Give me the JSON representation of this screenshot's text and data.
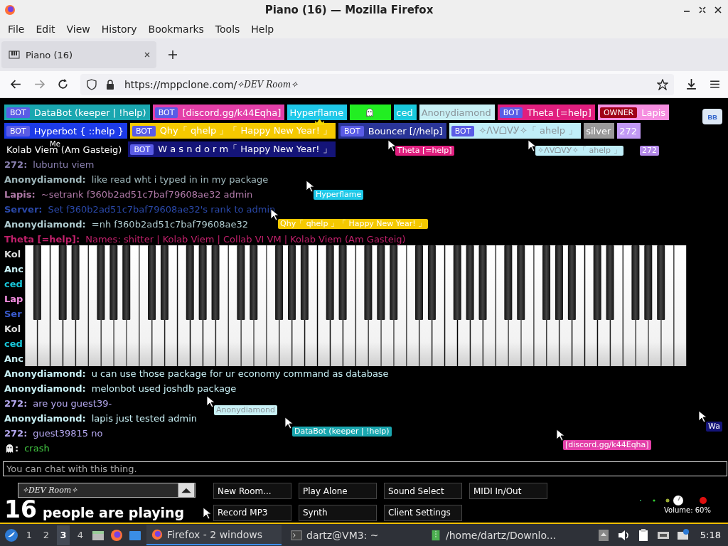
{
  "window": {
    "title": "Piano (16) — Mozilla Firefox"
  },
  "menu": [
    "File",
    "Edit",
    "View",
    "History",
    "Bookmarks",
    "Tools",
    "Help"
  ],
  "tabs": [
    {
      "label": "Piano (16)",
      "selected": true
    }
  ],
  "url": {
    "host": "https://mppclone.com/",
    "path": "✧DEV Room✧"
  },
  "participant_rows": [
    {
      "users": [
        {
          "badge": "BOT",
          "name": "DataBot (keeper | !help)",
          "color": "#1aa7b0"
        },
        {
          "badge": "BOT",
          "name": "[discord.gg/k44Eqha]",
          "color": "#e33fa8"
        },
        {
          "name": "Hyperflame",
          "color": "#1ec8e8"
        },
        {
          "kind": "ghost",
          "color": "#22ee22"
        },
        {
          "name": "ced",
          "color": "#19c9dc"
        },
        {
          "name": "Anonydiamond",
          "color": "#c8f0f5"
        },
        {
          "badge": "BOT",
          "name": "Theta [=help]",
          "color": "#e01e7e"
        },
        {
          "badge": "OWNER",
          "name": "Lapis",
          "color": "#f58ee0"
        }
      ]
    },
    {
      "users": [
        {
          "badge": "BOT",
          "name": "Hyperbot { ::help }",
          "color": "#1d3be8"
        },
        {
          "badge": "BOT",
          "name": "Qhy「 qhelp 」「 Happy New Year! 」",
          "color": "#f5c900"
        },
        {
          "badge": "BOT",
          "name": "Bouncer [//help]",
          "color": "#2a3598"
        },
        {
          "badge": "BOT",
          "name": "✧ᐱᐯᗝᐯᎩ✧「 ahelp 」",
          "color": "#c0eef8"
        },
        {
          "name": "silver",
          "color": "#999999"
        },
        {
          "name": "272",
          "color": "#c29af5"
        }
      ]
    },
    {
      "users": [
        {
          "name": "Kolab Viem (Am Gasteig)",
          "color": "#000000"
        },
        {
          "badge": "BOT",
          "name": "W a s n d o r m「 Happy New Year! 」",
          "color": "#141478"
        }
      ]
    }
  ],
  "corner_button": "ʙʙ",
  "chat": [
    {
      "kind": "message",
      "name": "272:",
      "text": "lubuntu viem",
      "color": "#8a80b0"
    },
    {
      "kind": "message",
      "name": "Anonydiamond:",
      "text": "like read wht i typed in in my package",
      "color": "#a0b8bc"
    },
    {
      "kind": "message",
      "name": "Lapis:",
      "text": "~setrank f360b2ad51c7baf79608ae32 admin",
      "color": "#b07aa8"
    },
    {
      "kind": "message",
      "name": "Server:",
      "text": "Set f360b2ad51c7baf79608ae32's rank to admin",
      "color": "#2a48a8"
    },
    {
      "kind": "message",
      "name": "Anonydiamond:",
      "text": "=nh f360b2ad51c7baf79608ae32",
      "color": "#b0ccd0"
    },
    {
      "kind": "message",
      "name": "Theta [=help]:",
      "text": "Names: shitter | Kolab Viem | Collab VI VM | Kolab Viem (Am Gasteig)",
      "color": "#c0206a"
    },
    {
      "kind": "stub",
      "name": "Kol",
      "color": "#dddddd"
    },
    {
      "kind": "stub",
      "name": "Anc",
      "color": "#c8f0f5"
    },
    {
      "kind": "stub",
      "name": "ced",
      "color": "#19c9dc"
    },
    {
      "kind": "stub",
      "name": "Lap",
      "color": "#f58ee0"
    },
    {
      "kind": "stub",
      "name": "Ser",
      "color": "#3a5cd0"
    },
    {
      "kind": "stub",
      "name": "Kol",
      "color": "#dddddd"
    },
    {
      "kind": "stub",
      "name": "ced",
      "color": "#19c9dc"
    },
    {
      "kind": "stub",
      "name": "Anc",
      "color": "#c8f0f5"
    },
    {
      "kind": "message",
      "name": "Anonydiamond:",
      "text": "u can use those package for ur economy command as database",
      "color": "#c8f0f5"
    },
    {
      "kind": "message",
      "name": "Anonydiamond:",
      "text": "melonbot used joshdb package",
      "color": "#c8f0f5"
    },
    {
      "kind": "message",
      "name": "272:",
      "text": "are you guest39-",
      "color": "#b5a8f0"
    },
    {
      "kind": "message",
      "name": "Anonydiamond:",
      "text": "lapis just tested admin",
      "color": "#c8f0f5"
    },
    {
      "kind": "message",
      "name": "272:",
      "text": "guest39815 no",
      "color": "#b5a8f0"
    },
    {
      "kind": "ghost",
      "name": ":",
      "text": "crash",
      "color": "#44cc44"
    }
  ],
  "cursors": [
    {
      "pointer": true,
      "label": "Theta [=help]",
      "color": "#e01e7e"
    },
    {
      "pointer": true,
      "label": "✧ᐱᐯᗝᐯᎩ✧「 ahelp 」",
      "color": "#c0eef8"
    },
    {
      "pointer": true,
      "label": "Hyperflame",
      "color": "#1ec8e8"
    },
    {
      "pointer": true,
      "label": "Qhy「 qhelp 」「 Happy New Year! 」",
      "color": "#f5c900"
    },
    {
      "pointer": true,
      "label": "Anonydiamond",
      "color": "#c8f0f5"
    },
    {
      "pointer": true,
      "label": "DataBot (keeper | !help)",
      "color": "#1aa7b0"
    },
    {
      "pointer": true,
      "label": "[discord.gg/k44Eqha]",
      "color": "#e33fa8"
    },
    {
      "pointer": true,
      "label": "Wa",
      "color": "#141478"
    },
    {
      "pointer": false,
      "label": "272",
      "color": "#b48ae8"
    },
    {
      "pointer": true
    }
  ],
  "own_label": "Me",
  "chat_input": {
    "placeholder": "You can chat with this thing."
  },
  "room": {
    "name": "✧DEV Room✧",
    "count": "16",
    "count_text": "people are playing"
  },
  "buttons": [
    "New Room...",
    "Play Alone",
    "Sound Select",
    "MIDI In/Out",
    "Record MP3",
    "Synth",
    "Client Settings"
  ],
  "volume": {
    "label": "Volume: 60%"
  },
  "taskbar": {
    "workspaces": [
      {
        "label": "1",
        "selected": false
      },
      {
        "label": "2",
        "selected": false
      },
      {
        "label": "3",
        "selected": true
      },
      {
        "label": "4",
        "selected": false
      }
    ],
    "tasks": [
      {
        "kind": "firefox",
        "label": "Firefox - 2 windows",
        "selected": true
      },
      {
        "kind": "terminal",
        "label": "dartz@VM3: ~",
        "selected": false
      },
      {
        "kind": "archive",
        "label": "/home/dartz/Downlo...",
        "selected": false
      }
    ],
    "clock": "5:18"
  }
}
